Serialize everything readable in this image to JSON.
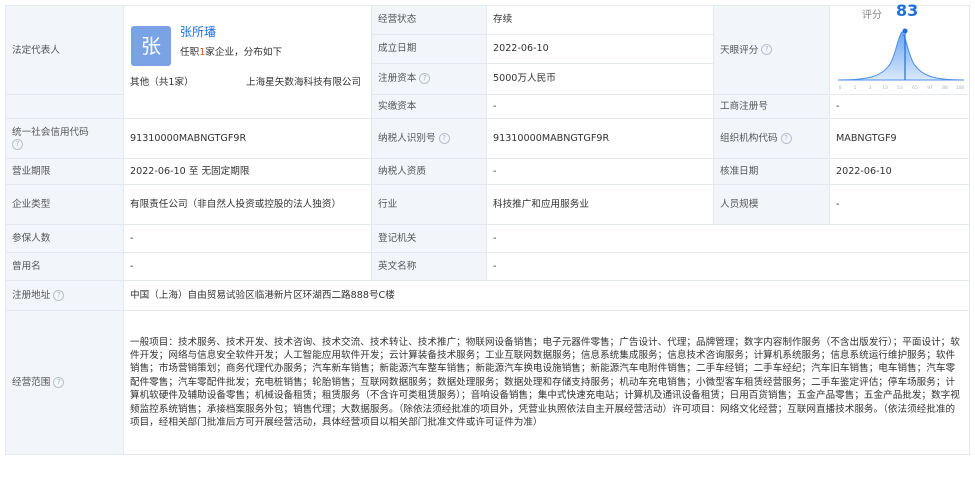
{
  "rep": {
    "label": "法定代表人",
    "avatar_char": "张",
    "name": "张所璠",
    "sub_prefix": "任职",
    "sub_count": "1",
    "sub_suffix": "家企业，分布如下",
    "other": "其他（共1家）",
    "company": "上海星矢数海科技有限公司"
  },
  "top": {
    "status_label": "经营状态",
    "status_value": "存续",
    "founded_label": "成立日期",
    "founded_value": "2022-06-10",
    "capital_label": "注册资本",
    "capital_value": "5000万人民币",
    "paid_label": "实缴资本",
    "paid_value": "-",
    "score_label": "天眼评分",
    "reg_no_label": "工商注册号",
    "reg_no_value": "-"
  },
  "score": {
    "caption": "评分",
    "value": 83,
    "scale_ticks": [
      "0",
      "1",
      "3",
      "13",
      "53",
      "65",
      "97",
      "88",
      "100"
    ]
  },
  "rows": {
    "credit_code_label": "统一社会信用代码",
    "credit_code_value": "91310000MABNGTGF9R",
    "taxpayer_id_label": "纳税人识别号",
    "taxpayer_id_value": "91310000MABNGTGF9R",
    "org_code_label": "组织机构代码",
    "org_code_value": "MABNGTGF9",
    "term_label": "营业期限",
    "term_value": "2022-06-10 至 无固定期限",
    "tax_quality_label": "纳税人资质",
    "tax_quality_value": "-",
    "approve_label": "核准日期",
    "approve_value": "2022-06-10",
    "type_label": "企业类型",
    "type_value": "有限责任公司（非自然人投资或控股的法人独资）",
    "industry_label": "行业",
    "industry_value": "科技推广和应用服务业",
    "staff_label": "人员规模",
    "staff_value": "-",
    "insured_label": "参保人数",
    "insured_value": "-",
    "authority_label": "登记机关",
    "authority_value": "-",
    "former_label": "曾用名",
    "former_value": "-",
    "english_label": "英文名称",
    "english_value": "-",
    "address_label": "注册地址",
    "address_value": "中国（上海）自由贸易试验区临港新片区环湖西二路888号C楼",
    "scope_label": "经营范围",
    "scope_value": "一般项目：技术服务、技术开发、技术咨询、技术交流、技术转让、技术推广；物联网设备销售；电子元器件零售；广告设计、代理；品牌管理；数字内容制作服务（不含出版发行）；平面设计；软件开发；网络与信息安全软件开发；人工智能应用软件开发；云计算装备技术服务；工业互联网数据服务；信息系统集成服务；信息技术咨询服务；计算机系统服务；信息系统运行维护服务；软件销售；市场营销策划；商务代理代办服务；汽车新车销售；新能源汽车整车销售；新能源汽车换电设施销售；新能源汽车电附件销售；二手车经销；二手车经纪；汽车旧车销售；电车销售；汽车零配件零售；汽车零配件批发；充电桩销售；轮胎销售；互联网数据服务；数据处理服务；数据处理和存储支持服务；机动车充电销售；小微型客车租赁经营服务；二手车鉴定评估；停车场服务；计算机软硬件及辅助设备零售；机械设备租赁；租赁服务（不含许可类租赁服务）；音响设备销售；集中式快速充电站；计算机及通讯设备租赁；日用百货销售；五金产品零售；五金产品批发；数字视频监控系统销售；承接档案服务外包；销售代理；大数据服务。（除依法须经批准的项目外，凭营业执照依法自主开展经营活动）许可项目：网络文化经营；互联网直播技术服务。（依法须经批准的项目，经相关部门批准后方可开展经营活动，具体经营项目以相关部门批准文件或许可证件为准）"
  },
  "colors": {
    "accent": "#1f6fdd",
    "label_bg": "#f2f5fa",
    "border": "#e4e8ef",
    "highlight": "#e8553d"
  }
}
